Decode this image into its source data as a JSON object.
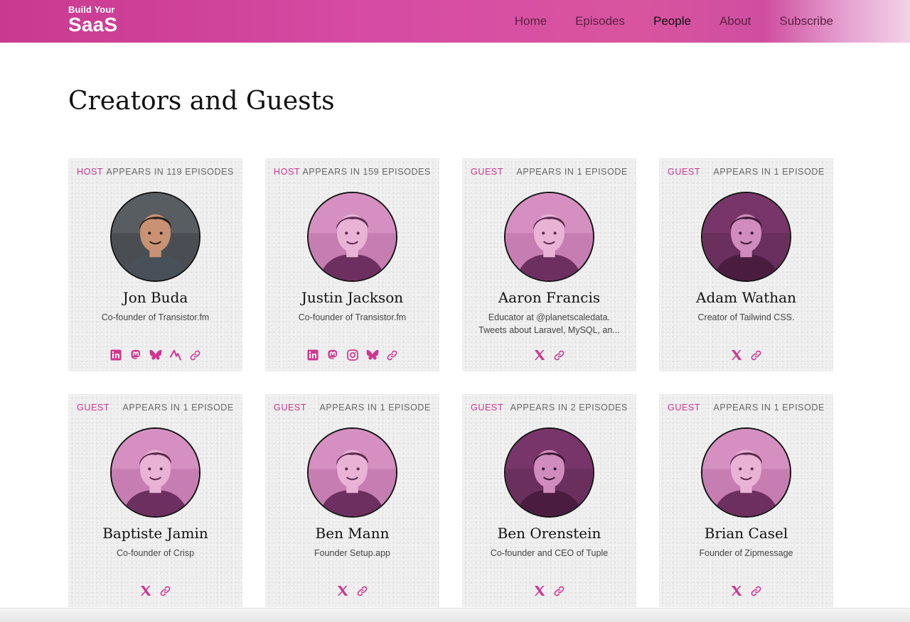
{
  "header": {
    "logo_line1": "Build Your",
    "logo_line2": "SaaS",
    "nav": [
      {
        "label": "Home"
      },
      {
        "label": "Episodes"
      },
      {
        "label": "People",
        "active": true
      },
      {
        "label": "About"
      },
      {
        "label": "Subscribe"
      }
    ]
  },
  "page_title": "Creators and Guests",
  "colors": {
    "brand_pink": "#d0358f",
    "header_pink": "#d64ba4"
  },
  "people": [
    {
      "role": "HOST",
      "appears": "APPEARS IN 119 EPISODES",
      "name": "Jon Buda",
      "bio": "Co-founder of Transistor.fm",
      "photo_style": "natural",
      "socials": [
        "linkedin-icon",
        "mastodon-icon",
        "bluesky-icon",
        "activity-icon",
        "link-icon"
      ]
    },
    {
      "role": "HOST",
      "appears": "APPEARS IN 159 EPISODES",
      "name": "Justin Jackson",
      "bio": "Co-founder of Transistor.fm",
      "photo_style": "pink",
      "socials": [
        "linkedin-icon",
        "mastodon-icon",
        "instagram-icon",
        "bluesky-icon",
        "link-icon"
      ]
    },
    {
      "role": "GUEST",
      "appears": "APPEARS IN 1 EPISODE",
      "name": "Aaron Francis",
      "bio": "Educator at @planetscaledata. Tweets about Laravel, MySQL, an...",
      "photo_style": "pink",
      "socials": [
        "x-icon",
        "link-icon"
      ]
    },
    {
      "role": "GUEST",
      "appears": "APPEARS IN 1 EPISODE",
      "name": "Adam Wathan",
      "bio": "Creator of Tailwind CSS.",
      "photo_style": "dark-pink",
      "socials": [
        "x-icon",
        "link-icon"
      ]
    },
    {
      "role": "GUEST",
      "appears": "APPEARS IN 1 EPISODE",
      "name": "Baptiste Jamin",
      "bio": "Co-founder of Crisp",
      "photo_style": "pink",
      "socials": [
        "x-icon",
        "link-icon"
      ]
    },
    {
      "role": "GUEST",
      "appears": "APPEARS IN 1 EPISODE",
      "name": "Ben Mann",
      "bio": "Founder Setup.app",
      "photo_style": "pink",
      "socials": [
        "x-icon",
        "link-icon"
      ]
    },
    {
      "role": "GUEST",
      "appears": "APPEARS IN 2 EPISODES",
      "name": "Ben Orenstein",
      "bio": "Co-founder and CEO of Tuple",
      "photo_style": "dark-pink",
      "socials": [
        "x-icon",
        "link-icon"
      ]
    },
    {
      "role": "GUEST",
      "appears": "APPEARS IN 1 EPISODE",
      "name": "Brian Casel",
      "bio": "Founder of Zipmessage",
      "photo_style": "pink",
      "socials": [
        "x-icon",
        "link-icon"
      ]
    }
  ]
}
